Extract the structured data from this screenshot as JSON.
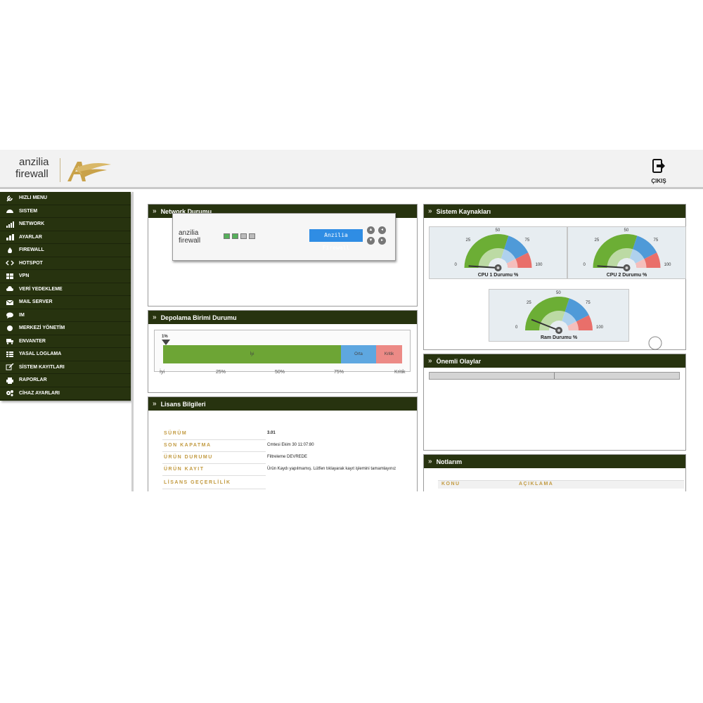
{
  "header": {
    "logo_line1": "anzilia",
    "logo_line2": "firewall",
    "exit_label": "ÇIKIŞ"
  },
  "sidebar": {
    "items": [
      {
        "label": "HIZLI MENU",
        "icon": "wrench-icon"
      },
      {
        "label": "SISTEM",
        "icon": "dashboard-icon"
      },
      {
        "label": "NETWORK",
        "icon": "signal-icon"
      },
      {
        "label": "AYARLAR",
        "icon": "sliders-icon"
      },
      {
        "label": "FIREWALL",
        "icon": "fire-icon"
      },
      {
        "label": "HOTSPOT",
        "icon": "code-icon"
      },
      {
        "label": "VPN",
        "icon": "windows-icon"
      },
      {
        "label": "VERİ YEDEKLEME",
        "icon": "cloud-icon"
      },
      {
        "label": "MAIL SERVER",
        "icon": "envelope-icon"
      },
      {
        "label": "IM",
        "icon": "chat-icon"
      },
      {
        "label": "MERKEZİ YÖNETİM",
        "icon": "circle-icon"
      },
      {
        "label": "ENVANTER",
        "icon": "truck-icon"
      },
      {
        "label": "YASAL LOGLAMA",
        "icon": "grid-icon"
      },
      {
        "label": "SİSTEM KAYITLARI",
        "icon": "edit-icon"
      },
      {
        "label": "RAPORLAR",
        "icon": "print-icon"
      },
      {
        "label": "CİHAZ AYARLARI",
        "icon": "gears-icon"
      }
    ]
  },
  "network": {
    "title": "Network Durumu",
    "device_logo_line1": "anzilia",
    "device_logo_line2": "firewall",
    "lcd_text": "Anzilia Firewall"
  },
  "storage": {
    "title": "Depolama Birimi Durumu",
    "usage_label": "1%",
    "usage_value": 1,
    "segments": [
      "İyi",
      "Orta",
      "Kritik"
    ],
    "ticks": [
      "İyi",
      "25%",
      "50%",
      "75%",
      "Kritik"
    ],
    "colors": {
      "good": "#6da535",
      "mid": "#5ea7e0",
      "crit": "#ec8a86"
    }
  },
  "license": {
    "title": "Lisans Bilgileri",
    "rows": [
      {
        "key": "SÜRÜM",
        "value": "3.01"
      },
      {
        "key": "SON KAPATMA",
        "value": "Cmtesi Ekim 30 11:07:80"
      },
      {
        "key": "ÜRÜN DURUMU",
        "value": "Filtreleme DEVREDE"
      },
      {
        "key": "ÜRÜN KAYIT",
        "value": "Ürün Kaydı yapılmamış. Lütfen tıklayarak kayıt işlemini tamamlayınız"
      },
      {
        "key": "LİSANS GEÇERLİLİK",
        "value": ""
      }
    ]
  },
  "resources": {
    "title": "Sistem Kaynakları",
    "scale": [
      "0",
      "25",
      "50",
      "75",
      "100"
    ],
    "gauges": [
      {
        "label": "CPU 1 Durumu %",
        "value": 2
      },
      {
        "label": "CPU 2 Durumu %",
        "value": 2
      },
      {
        "label": "Ram Durumu %",
        "value": 12
      }
    ]
  },
  "events": {
    "title": "Önemli Olaylar"
  },
  "notes": {
    "title": "Notlarım",
    "col1": "KONU",
    "col2": "AÇIKLAMA"
  }
}
